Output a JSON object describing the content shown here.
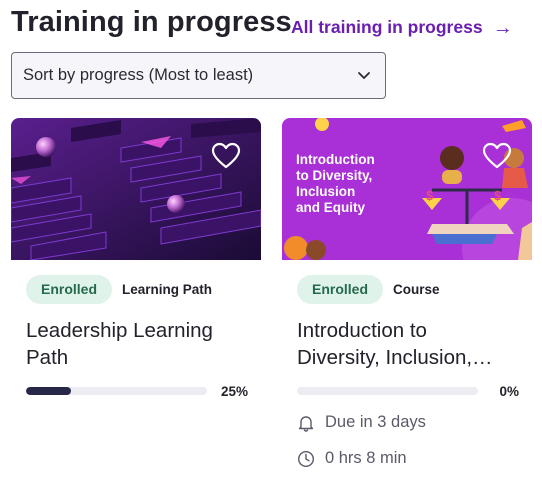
{
  "header": {
    "title": "Training in progress",
    "all_link": "All training in progress",
    "all_link_icon": "arrow-right-icon"
  },
  "sort": {
    "selected": "Sort by progress (Most to least)",
    "icon": "chevron-down-icon"
  },
  "colors": {
    "accent": "#6b1fb0",
    "enrolled_bg": "#dff3ea",
    "enrolled_text": "#256a4d",
    "progress_fill": "#272848",
    "progress_track": "#ececf2"
  },
  "cards": [
    {
      "status": "Enrolled",
      "type": "Learning Path",
      "title_lines": [
        "Leadership Learning",
        "Path"
      ],
      "progress_label": "25%",
      "progress_fraction": 0.25,
      "favorite_icon": "heart-icon"
    },
    {
      "status": "Enrolled",
      "type": "Course",
      "title_lines": [
        "Introduction to",
        "Diversity, Inclusion,…"
      ],
      "progress_label": "0%",
      "progress_fraction": 0,
      "favorite_icon": "heart-icon",
      "thumbnail_text": [
        "Introduction",
        "to Diversity,",
        "Inclusion",
        "and Equity"
      ],
      "due": "Due in 3 days",
      "due_icon": "bell-icon",
      "duration": "0 hrs 8 min",
      "duration_icon": "clock-icon"
    }
  ]
}
